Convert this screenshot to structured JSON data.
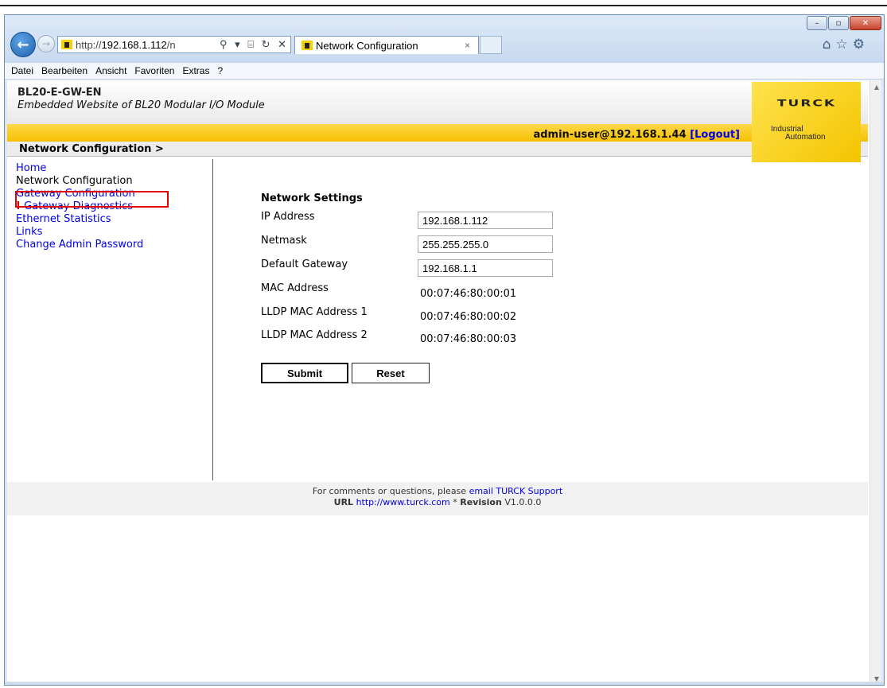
{
  "browser": {
    "address_prefix": "http://",
    "address_host": "192.168.1.112",
    "address_suffix": "/n",
    "address_icons": "⚲ ▾ ⌸ ↻ ✕",
    "tab_title": "Network Configuration",
    "tab_close": "×",
    "window_buttons": [
      "–",
      "▫",
      "✕"
    ],
    "toolbar_icons": "⌂☆⚙",
    "menu": [
      "Datei",
      "Bearbeiten",
      "Ansicht",
      "Favoriten",
      "Extras",
      "?"
    ]
  },
  "header": {
    "product": "BL20-E-GW-EN",
    "subtitle": "Embedded Website of BL20 Modular I/O Module",
    "user": "admin-user@192.168.1.44",
    "logout": "[Logout]",
    "logo_text": "TURCK",
    "logo_line1": "Industrial",
    "logo_line2": "Automation"
  },
  "breadcrumb": "Network Configuration >",
  "sidebar": {
    "items": [
      {
        "label": "Home"
      },
      {
        "label": "Network Configuration"
      },
      {
        "label": "Gateway Configuration"
      },
      {
        "label": "Gateway Diagnostics",
        "warning": "!"
      },
      {
        "label": "Ethernet Statistics"
      },
      {
        "label": "Links"
      },
      {
        "label": "Change Admin Password"
      }
    ]
  },
  "network": {
    "title": "Network Settings",
    "ip_label": "IP Address",
    "ip_value": "192.168.1.112",
    "netmask_label": "Netmask",
    "netmask_value": "255.255.255.0",
    "gateway_label": "Default Gateway",
    "gateway_value": "192.168.1.1",
    "mac_label": "MAC Address",
    "mac_value": "00:07:46:80:00:01",
    "lldp1_label": "LLDP MAC Address 1",
    "lldp1_value": "00:07:46:80:00:02",
    "lldp2_label": "LLDP MAC Address 2",
    "lldp2_value": "00:07:46:80:00:03",
    "submit": "Submit",
    "reset": "Reset"
  },
  "footer": {
    "comment_prefix": "For comments or questions, please",
    "support_link": "email TURCK Support",
    "url_label": "URL",
    "url_link": "http://www.turck.com",
    "sep": "*",
    "revision_label": "Revision",
    "revision_value": "V1.0.0.0"
  }
}
